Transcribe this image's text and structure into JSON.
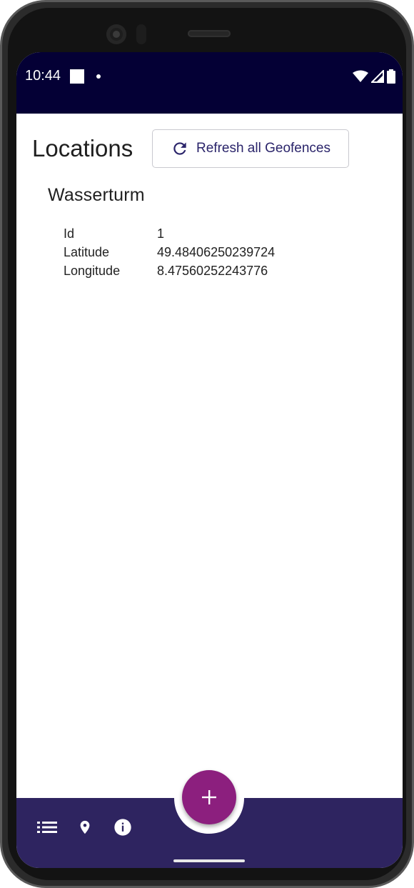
{
  "status_bar": {
    "time": "10:44",
    "icons": [
      "notification-square-icon",
      "dot-icon",
      "wifi-icon",
      "signal-icon",
      "battery-icon"
    ]
  },
  "page": {
    "title": "Locations",
    "refresh_label": "Refresh all Geofences"
  },
  "location": {
    "name": "Wasserturm",
    "fields": [
      {
        "key": "Id",
        "value": "1"
      },
      {
        "key": "Latitude",
        "value": "49.48406250239724"
      },
      {
        "key": "Longitude",
        "value": "8.47560252243776"
      }
    ]
  },
  "bottom_nav": {
    "items": [
      "list-icon",
      "location-pin-icon",
      "info-icon"
    ],
    "fab_icon": "plus-icon"
  },
  "colors": {
    "status_bar": "#040035",
    "bottom_bar": "#2e2460",
    "fab": "#8c1f7e",
    "accent_text": "#2a246a"
  }
}
